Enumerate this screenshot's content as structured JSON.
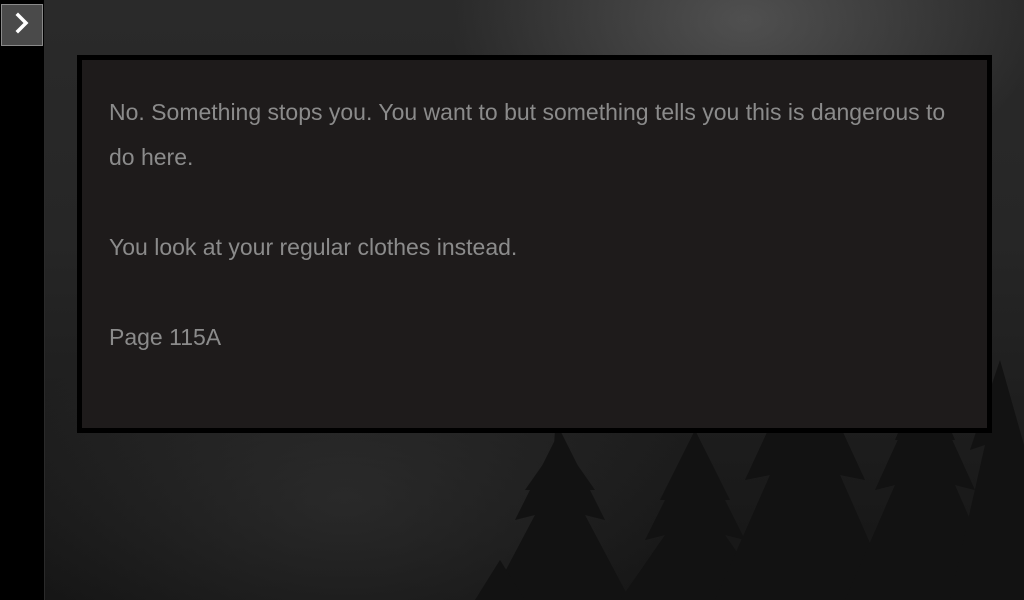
{
  "sidebar": {
    "toggle_icon": "chevron-right-icon"
  },
  "passage": {
    "paragraphs": [
      "No. Something stops you. You want to but something tells you this is dangerous to do here.",
      "You look at your regular clothes instead.",
      "Page 115A"
    ]
  },
  "colors": {
    "passage_background": "#1e1b1b",
    "passage_text": "#8b8b8b",
    "sidebar_background": "#000000"
  }
}
